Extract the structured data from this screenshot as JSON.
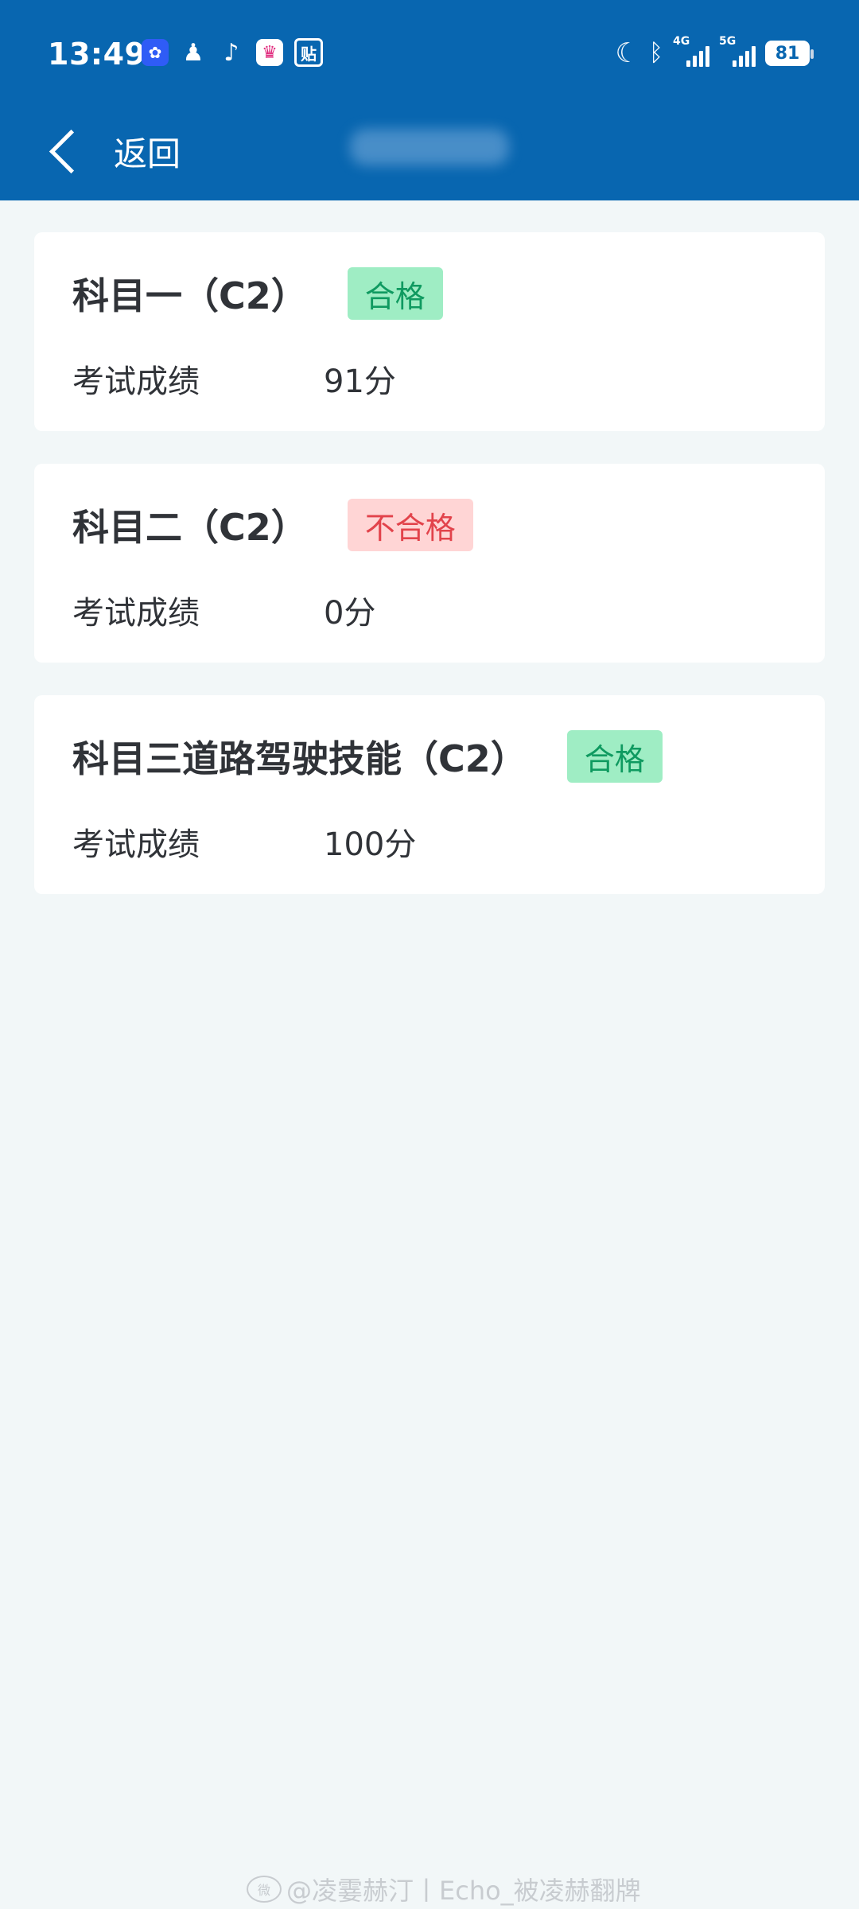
{
  "status_bar": {
    "time": "13:49",
    "apps": [
      {
        "icon": "baidu-icon",
        "glyph": "✿"
      },
      {
        "icon": "qq-icon",
        "glyph": "♟"
      },
      {
        "icon": "tiktok-icon",
        "glyph": "♪"
      },
      {
        "icon": "crown-app-icon",
        "glyph": "♛"
      },
      {
        "icon": "tieba-icon",
        "glyph": "贴"
      }
    ],
    "network_1": "4G",
    "network_2": "5G",
    "battery": "81"
  },
  "nav": {
    "back_label": "返回"
  },
  "exams": [
    {
      "title": "科目一（C2）",
      "status": "合格",
      "status_type": "pass",
      "score_label": "考试成绩",
      "score": "91分"
    },
    {
      "title": "科目二（C2）",
      "status": "不合格",
      "status_type": "fail",
      "score_label": "考试成绩",
      "score": "0分"
    },
    {
      "title": "科目三道路驾驶技能（C2）",
      "status": "合格",
      "status_type": "pass",
      "score_label": "考试成绩",
      "score": "100分"
    }
  ],
  "watermark": {
    "text": "@凌霎赫汀丨Echo_被凌赫翻牌"
  },
  "colors": {
    "header": "#0866b0",
    "background": "#f2f7f8",
    "pass_bg": "#9fedc4",
    "pass_text": "#0f9a60",
    "fail_bg": "#ffd5d5",
    "fail_text": "#e2434b"
  }
}
